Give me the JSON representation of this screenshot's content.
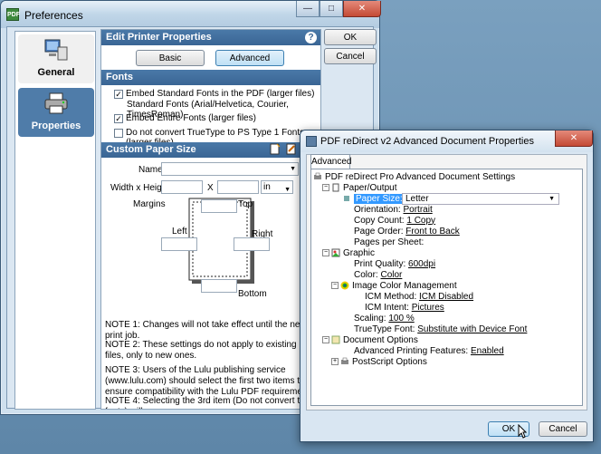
{
  "preferences": {
    "title": "Preferences",
    "app_icon_text": "PDF",
    "sidebar": [
      {
        "label": "General",
        "icon": "general-icon"
      },
      {
        "label": "Properties",
        "icon": "printer-icon"
      }
    ],
    "edit_header": "Edit Printer Properties",
    "basic_label": "Basic",
    "advanced_label": "Advanced",
    "ok_label": "OK",
    "cancel_label": "Cancel",
    "fonts_header": "Fonts",
    "fonts": [
      {
        "label": "Embed Standard Fonts in the PDF (larger files)",
        "checked": true,
        "sub": "Standard Fonts (Arial/Helvetica, Courier, TimesRoman)"
      },
      {
        "label": "Embed Entire Fonts (larger files)",
        "checked": true
      },
      {
        "label": "Do not convert TrueType to PS Type 1 Fonts (larger files)",
        "checked": false
      }
    ],
    "custom_header": "Custom Paper Size",
    "name_label": "Name",
    "wh_label": "Width x Height",
    "x_label": "X",
    "unit": "in",
    "margins_label": "Margins",
    "top_label": "Top",
    "left_label": "Left",
    "right_label": "Right",
    "bottom_label": "Bottom",
    "notes": [
      "NOTE 1: Changes will not take effect until the next print job.",
      "NOTE 2: These settings do not apply to existing PDF files, only to new ones.",
      "NOTE 3: Users of the Lulu publishing service (www.lulu.com) should select the first two items to ensure compatibility with the Lulu PDF requirements.",
      "NOTE 4: Selecting the 3rd item (Do not convert to PS fonts) will"
    ]
  },
  "advanced": {
    "title": "PDF reDirect v2 Advanced Document Properties",
    "tab": "Advanced",
    "root": "PDF reDirect Pro Advanced Document Settings",
    "paper_output": "Paper/Output",
    "paper_size_label": "Paper Size:",
    "paper_size_value": "Letter",
    "orientation_label": "Orientation:",
    "orientation_value": "Portrait",
    "copy_label": "Copy Count:",
    "copy_value": "1 Copy",
    "order_label": "Page Order:",
    "order_value": "Front to Back",
    "pps_label": "Pages per Sheet:",
    "graphic": "Graphic",
    "quality_label": "Print Quality:",
    "quality_value": "600dpi",
    "color_label": "Color:",
    "color_value": "Color",
    "icm": "Image Color Management",
    "icm_method_label": "ICM Method:",
    "icm_method_value": "ICM Disabled",
    "icm_intent_label": "ICM Intent:",
    "icm_intent_value": "Pictures",
    "scaling_label": "Scaling:",
    "scaling_value": "100 %",
    "tt_label": "TrueType Font:",
    "tt_value": "Substitute with Device Font",
    "doc_options": "Document Options",
    "apf_label": "Advanced Printing Features:",
    "apf_value": "Enabled",
    "ps_options": "PostScript Options",
    "ok_label": "OK",
    "cancel_label": "Cancel"
  },
  "colors": {
    "accent": "#3a6594",
    "selection": "#3399ff",
    "sidebar_selected": "#4f7ca9"
  }
}
